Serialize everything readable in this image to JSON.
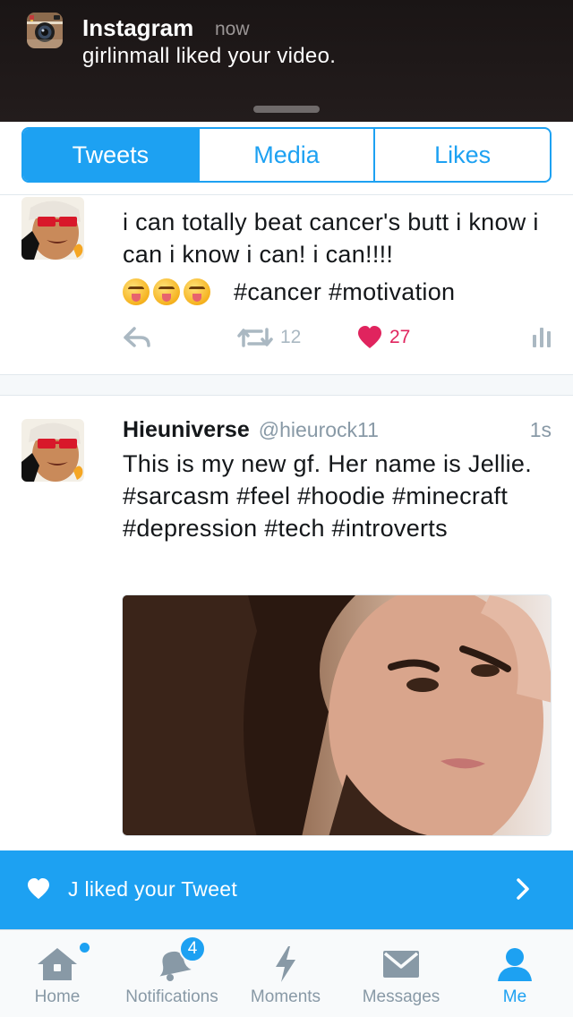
{
  "notification": {
    "app": "Instagram",
    "time": "now",
    "message": "girlinmall liked your video."
  },
  "tabs": {
    "items": [
      {
        "label": "Tweets",
        "active": true
      },
      {
        "label": "Media",
        "active": false
      },
      {
        "label": "Likes",
        "active": false
      }
    ]
  },
  "tweets": [
    {
      "text": "i can totally beat cancer's butt i know i can i know i can! i can!!!!",
      "emoji": [
        "squinting-face-with-tongue",
        "squinting-face-with-tongue",
        "squinting-face-with-tongue"
      ],
      "hashtags": "#cancer #motivation",
      "retweets": "12",
      "likes": "27",
      "liked": true
    },
    {
      "name": "Hieuniverse",
      "handle": "@hieurock11",
      "time": "1s",
      "text": "This is my new gf. Her name is Jellie. #sarcasm #feel #hoodie #minecraft #depression #tech #introverts"
    }
  ],
  "toast": {
    "text": "J liked your Tweet"
  },
  "tabbar": {
    "home": "Home",
    "notifications": "Notifications",
    "notifications_badge": "4",
    "moments": "Moments",
    "messages": "Messages",
    "me": "Me"
  },
  "colors": {
    "accent": "#1da1f2",
    "like": "#e0245e",
    "muted": "#8899a6"
  }
}
